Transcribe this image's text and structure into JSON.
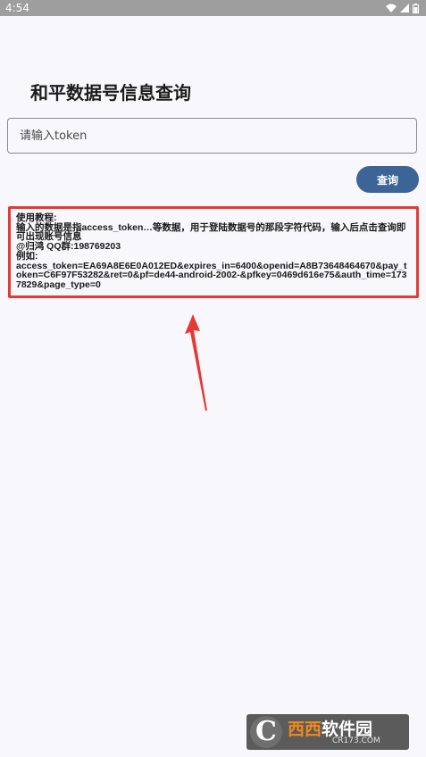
{
  "status_bar": {
    "time": "4:54",
    "icons": [
      "wifi-icon",
      "signal-icon",
      "battery-icon"
    ]
  },
  "page": {
    "title": "和平数据号信息查询"
  },
  "token_input": {
    "placeholder": "请输入token",
    "value": ""
  },
  "query_button": {
    "label": "查询"
  },
  "help": {
    "lines": [
      "使用教程:",
      "输入的数据是指access_token…等数据，用于登陆数据号的那段字符代码，输入后点击查询即可出现账号信息",
      "@归鸿  QQ群:198769203",
      "例如:",
      "access_token=EA69A8E6E0A012ED&expires_in=6400&openid=A8B73648464670&pay_token=C6F97F53282&ret=0&pf=de44-android-2002-&pfkey=0469d616e75&auth_time=1737829&page_type=0"
    ]
  },
  "watermark": {
    "brand_a": "西西",
    "brand_b": "软件园",
    "domain": "CR173.COM"
  },
  "colors": {
    "accent": "#3c6496",
    "highlight": "#e53935",
    "status_bar": "#9e9e9e"
  }
}
